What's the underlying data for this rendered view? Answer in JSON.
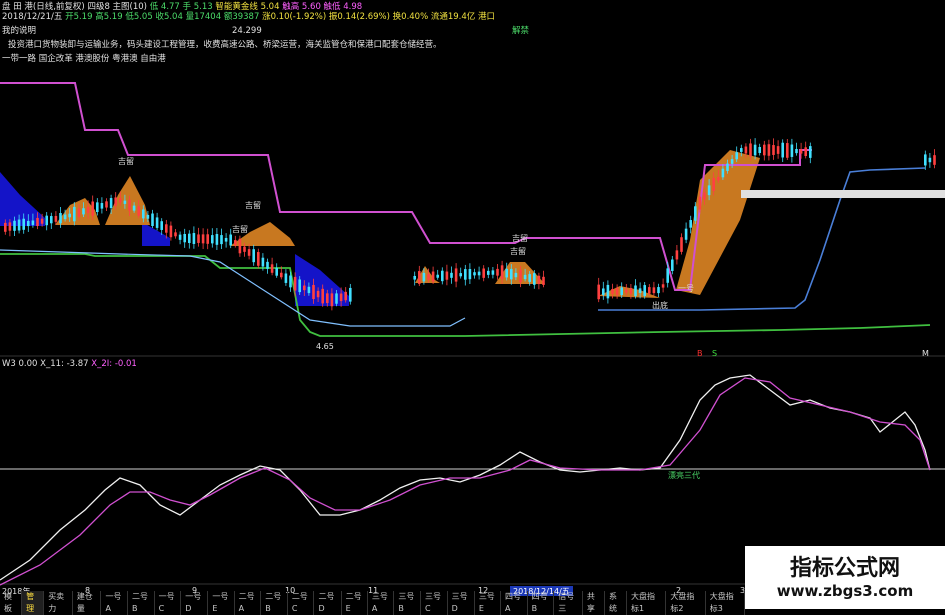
{
  "header": {
    "line1": [
      {
        "text": "盘 田 港(日线,前复权) 四级8 主图(10)",
        "color": "white"
      },
      {
        "text": "低 4.77 手 5.13",
        "color": "green"
      },
      {
        "text": "智能黄金线 5.04",
        "color": "yellow"
      },
      {
        "text": "触高 5.60 触低 4.98",
        "color": "mag"
      }
    ],
    "line2": [
      {
        "text": "2018/12/21/五",
        "color": "white"
      },
      {
        "text": "开5.19 高5.19 低5.05 收5.04 量17404 额39387",
        "color": "green"
      },
      {
        "text": "涨0.10(-1.92%) 振0.14(2.69%) 换0.40% 流通19.4亿 港口",
        "color": "yellow"
      }
    ],
    "info_label": "我的说明",
    "info_value": "24.299",
    "info_tag": "解禁",
    "desc1": "投资港口货物装卸与运输业务，码头建设工程管理，收费高速公路、桥梁运营，海关监管仓和保港口配套仓储经营。",
    "desc2": "一带一路 国企改革 港澳股份 粤港澳 自由港"
  },
  "annotations": {
    "price_low": "4.65",
    "buy_label_1": "B",
    "sell_label_1": "S",
    "right_tag": "M",
    "buy_points": [
      "吉留",
      "吉留",
      "吉留",
      "吉留",
      "吉留",
      "一号",
      "出底"
    ]
  },
  "indicator": {
    "label": "W3",
    "values": [
      {
        "text": "0.00 X_11: -3.87",
        "color": "white"
      },
      {
        "text": "X_2I: -0.01",
        "color": "mag"
      }
    ],
    "tag": "漂亮三代"
  },
  "x_axis": {
    "labels": [
      "2018年",
      "8",
      "9",
      "10",
      "11",
      "12",
      "2",
      "3"
    ]
  },
  "tabs": [
    {
      "label": "模板",
      "active": false
    },
    {
      "label": "管理",
      "active": true
    },
    {
      "label": "买卖力",
      "active": false
    },
    {
      "label": "建仓量",
      "active": false
    },
    {
      "label": "一号A",
      "active": false
    },
    {
      "label": "二号B",
      "active": false
    },
    {
      "label": "一号C",
      "active": false
    },
    {
      "label": "一号D",
      "active": false
    },
    {
      "label": "一号E",
      "active": false
    },
    {
      "label": "二号A",
      "active": false
    },
    {
      "label": "二号B",
      "active": false
    },
    {
      "label": "二号C",
      "active": false
    },
    {
      "label": "二号D",
      "active": false
    },
    {
      "label": "二号E",
      "active": false
    },
    {
      "label": "三号A",
      "active": false
    },
    {
      "label": "三号B",
      "active": false
    },
    {
      "label": "三号C",
      "active": false
    },
    {
      "label": "三号D",
      "active": false
    },
    {
      "label": "三号E",
      "active": false
    },
    {
      "label": "四号A",
      "active": false
    },
    {
      "label": "四号B",
      "active": false
    },
    {
      "label": "信号三",
      "active": false
    },
    {
      "label": "共享",
      "active": false
    },
    {
      "label": "系统",
      "active": false
    },
    {
      "label": "大盘指标1",
      "active": false
    },
    {
      "label": "大盘指标2",
      "active": false
    },
    {
      "label": "大盘指标3",
      "active": false
    }
  ],
  "date_highlight": "2018/12/14/五",
  "watermark": {
    "title": "指标公式网",
    "url": "www.zbgs3.com"
  },
  "colors": {
    "magenta_line": "#d050d0",
    "blue_line": "#4a7fd8",
    "green_line": "#40c040",
    "orange_fill": "#c87820",
    "blue_fill": "#1a1acf",
    "white_line": "#f0f0f0"
  }
}
